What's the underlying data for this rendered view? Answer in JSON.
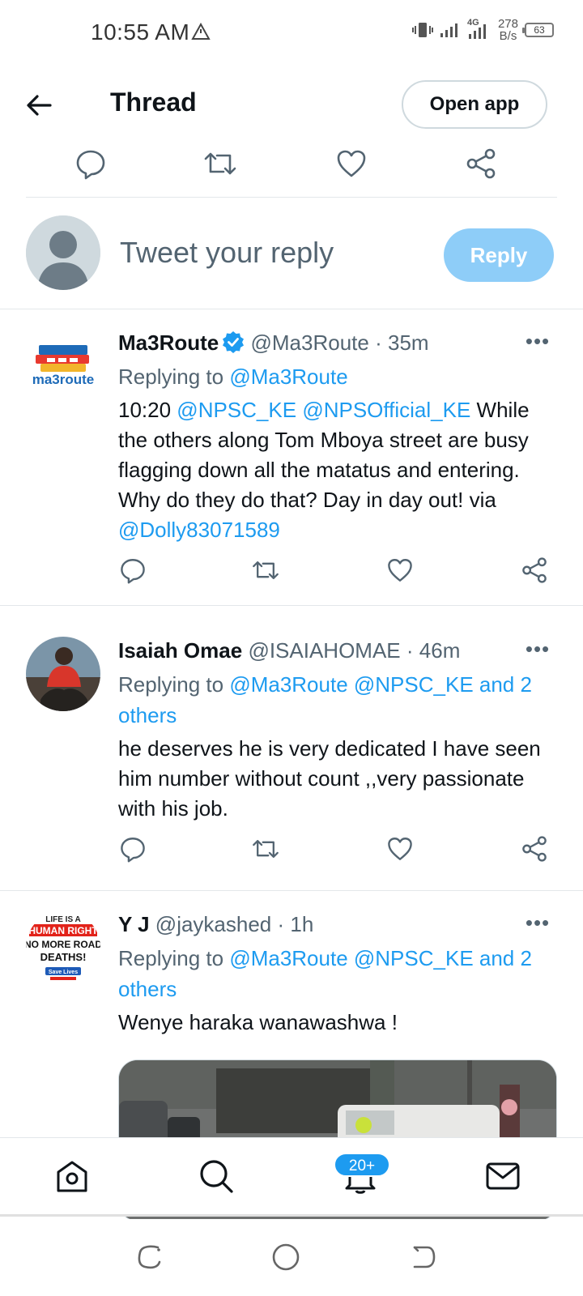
{
  "status_bar": {
    "time": "10:55 AM",
    "network_label": "4G",
    "net_speed_value": "278",
    "net_speed_unit": "B/s",
    "battery": "63"
  },
  "header": {
    "title": "Thread",
    "open_app_label": "Open app"
  },
  "compose": {
    "placeholder": "Tweet your reply",
    "reply_label": "Reply"
  },
  "tweets": [
    {
      "name": "Ma3Route",
      "verified": true,
      "handle": "@Ma3Route",
      "time": "35m",
      "replying_prefix": "Replying to",
      "replying_to": "@Ma3Route",
      "replying_suffix": "",
      "text_parts": [
        "10:20 ",
        "@NPSC_KE",
        " ",
        "@NPSOfficial_KE",
        "  While the others along Tom Mboya street are busy flagging down all the matatus and entering. Why do they do that? Day in day out! via ",
        "@Dolly83071589"
      ],
      "avatar_text": "ma3route"
    },
    {
      "name": "Isaiah Omae",
      "verified": false,
      "handle": "@ISAIAHOMAE",
      "time": "46m",
      "replying_prefix": "Replying to",
      "replying_to": "@Ma3Route @NPSC_KE and 2 others",
      "text": "he deserves he is very dedicated I have seen him number without count ,,very passionate with his job."
    },
    {
      "name": "Y J",
      "verified": false,
      "handle": "@jaykashed",
      "time": "1h",
      "replying_prefix": "Replying to",
      "replying_to": "@Ma3Route @NPSC_KE and 2 others",
      "text": "Wenye haraka wanawashwa !",
      "avatar_lines": [
        "LIFE IS A",
        "HUMAN RIGHT",
        "NO MORE ROAD",
        "DEATHS!",
        "Save Lives"
      ]
    }
  ],
  "separator": "·",
  "more_label": "•••",
  "bottom_nav": {
    "badge": "20+",
    "items": [
      "home-icon",
      "search-icon",
      "notifications-icon",
      "messages-icon"
    ]
  },
  "colors": {
    "link": "#1d9bf0",
    "reply_button": "#8ecdf8",
    "muted_text": "#536471",
    "divider": "#e3e7ea"
  }
}
